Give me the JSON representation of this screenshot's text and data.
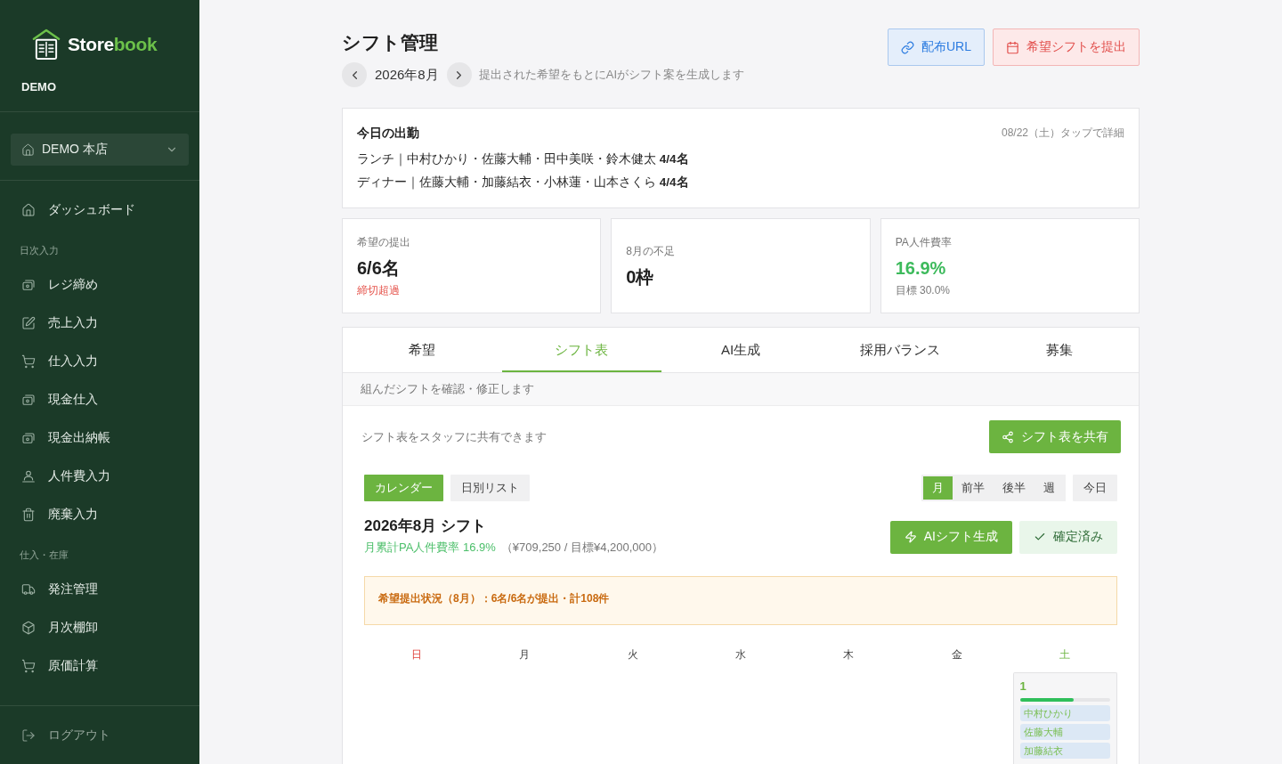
{
  "sidebar": {
    "logo": [
      {
        "text": "Store",
        "accent": false
      },
      {
        "text": "book",
        "accent": true
      }
    ],
    "org": "DEMO",
    "store_selector": {
      "value": "DEMO 本店"
    },
    "nav": [
      {
        "kind": "item",
        "label": "ダッシュボード",
        "selected": false
      },
      {
        "kind": "section",
        "label": "日次入力"
      },
      {
        "kind": "item",
        "label": "レジ締め",
        "selected": false
      },
      {
        "kind": "item",
        "label": "売上入力",
        "selected": false
      },
      {
        "kind": "item",
        "label": "仕入入力",
        "selected": false
      },
      {
        "kind": "item",
        "label": "現金仕入",
        "selected": false
      },
      {
        "kind": "item",
        "label": "現金出納帳",
        "selected": false
      },
      {
        "kind": "item",
        "label": "人件費入力",
        "selected": false
      },
      {
        "kind": "item",
        "label": "廃棄入力",
        "selected": false
      },
      {
        "kind": "section",
        "label": "仕入・在庫"
      },
      {
        "kind": "item",
        "label": "発注管理",
        "selected": false
      },
      {
        "kind": "item",
        "label": "月次棚卸",
        "selected": false
      },
      {
        "kind": "item",
        "label": "原価計算",
        "selected": false
      }
    ],
    "logout": "ログアウト"
  },
  "header": {
    "title": "シフト管理",
    "month": "2026年8月",
    "subtitle": "提出された希望をもとにAIがシフト案を生成します",
    "actions": [
      {
        "label": "配布URL",
        "kind": "info"
      },
      {
        "label": "希望シフトを提出",
        "kind": "danger"
      }
    ]
  },
  "today": {
    "title": "今日の出勤",
    "meta": "08/22（土）タップで詳細",
    "rows": [
      "ランチ｜中村ひかり・佐藤大輔・田中美咲・鈴木健太 **4/4名**",
      "ディナー｜佐藤大輔・加藤結衣・小林蓮・山本さくら **4/4名**"
    ]
  },
  "stats": [
    {
      "kind": "alert",
      "label": "希望の提出",
      "value": "6/6名",
      "note": "締切超過"
    },
    {
      "kind": "plain",
      "label": "8月の不足",
      "value": "0枠"
    },
    {
      "kind": "positive",
      "label": "PA人件費率",
      "value": "16.9%",
      "note": "目標 30.0%"
    }
  ],
  "tabs": [
    {
      "label": "希望",
      "selected": false
    },
    {
      "label": "シフト表",
      "selected": true
    },
    {
      "label": "AI生成",
      "selected": false
    },
    {
      "label": "採用バランス",
      "selected": false
    },
    {
      "label": "募集",
      "selected": false
    }
  ],
  "tab_hint": "組んだシフトを確認・修正します",
  "share": {
    "text": "シフト表をスタッフに共有できます",
    "button": "シフト表を共有"
  },
  "views": [
    {
      "label": "カレンダー",
      "selected": true
    },
    {
      "label": "日別リスト",
      "selected": false
    }
  ],
  "ranges": [
    {
      "label": "月",
      "selected": true
    },
    {
      "label": "前半",
      "selected": false
    },
    {
      "label": "後半",
      "selected": false
    },
    {
      "label": "週",
      "selected": false
    }
  ],
  "today_button": "今日",
  "schedule": {
    "title": "2026年8月 シフト",
    "rate": "月累計PA人件費率 16.9%",
    "rate_detail": "（¥709,250 / 目標¥4,200,000）",
    "actions": [
      {
        "label": "AIシフト生成",
        "kind": "primary"
      },
      {
        "label": "確定済み",
        "kind": "confirmed"
      }
    ]
  },
  "notice": "希望提出状況（8月）：6名/6名が提出・計108件",
  "calendar": {
    "weekdays": [
      {
        "label": "日",
        "kind": "sunday"
      },
      {
        "label": "月",
        "kind": "weekday"
      },
      {
        "label": "火",
        "kind": "weekday"
      },
      {
        "label": "水",
        "kind": "weekday"
      },
      {
        "label": "木",
        "kind": "weekday"
      },
      {
        "label": "金",
        "kind": "weekday"
      },
      {
        "label": "土",
        "kind": "saturday"
      }
    ],
    "weeks": [
      [
        {
          "kind": "blank"
        },
        {
          "kind": "blank"
        },
        {
          "kind": "blank"
        },
        {
          "kind": "blank"
        },
        {
          "kind": "blank"
        },
        {
          "kind": "blank"
        },
        {
          "kind": "day",
          "date": "1",
          "level": 0.6,
          "staff": [
            "中村ひかり",
            "佐藤大輔",
            "加藤結衣"
          ]
        }
      ]
    ]
  }
}
